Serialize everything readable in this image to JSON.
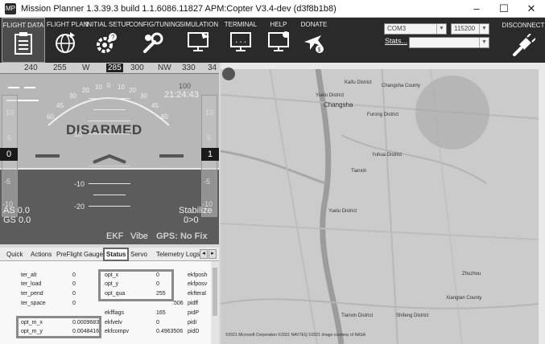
{
  "window": {
    "title": "Mission Planner 1.3.39.3 build 1.1.6086.11827 APM:Copter V3.4-dev (d3f8b1b8)",
    "minimize": "–",
    "maximize": "☐",
    "close": "✕"
  },
  "toolbar": {
    "items": [
      {
        "label": "FLIGHT DATA",
        "icon": "clipboard-icon"
      },
      {
        "label": "FLIGHT PLAN",
        "icon": "globe-icon"
      },
      {
        "label": "INITIAL SETUP",
        "icon": "gear-icon"
      },
      {
        "label": "CONFIG/TUNING",
        "icon": "wrench-icon"
      },
      {
        "label": "SIMULATION",
        "icon": "monitor-icon"
      },
      {
        "label": "TERMINAL",
        "icon": "terminal-icon"
      },
      {
        "label": "HELP",
        "icon": "help-monitor-icon"
      },
      {
        "label": "DONATE",
        "icon": "donate-plane-icon"
      }
    ],
    "port_value": "COM3",
    "baud_value": "115200",
    "stats_label": "Stats...",
    "stats_value": "",
    "disconnect_label": "DISCONNECT"
  },
  "hud": {
    "compass_labels": [
      "240",
      "255",
      "W",
      "285",
      "300",
      "NW",
      "330",
      "34"
    ],
    "status": "DISARMED",
    "time": "21:24:43",
    "speed_top": "100",
    "airspeed": "AS 0.0",
    "groundspeed": "GS 0.0",
    "mode": "Stabilize",
    "mode_sub": "0>0",
    "left_tape_value": "0",
    "right_tape_value": "1",
    "left_tape_ticks": [
      "10",
      "5",
      "-5",
      "-10"
    ],
    "right_tape_ticks": [
      "10",
      "5",
      "-5",
      "-10"
    ],
    "pitch_labels": [
      "10",
      "-10",
      "-20"
    ],
    "roll_labels": [
      "60",
      "45",
      "30",
      "20",
      "10",
      "0",
      "10",
      "20",
      "30",
      "45",
      "60"
    ],
    "ekf": "EKF",
    "vibe": "Vibe",
    "gps": "GPS: No Fix"
  },
  "tabs": {
    "items": [
      "Quick",
      "Actions",
      "PreFlight",
      "Gauges",
      "Status",
      "Servo",
      "Telemetry Logs"
    ],
    "active": "Status",
    "prev": "◂",
    "next": "▸"
  },
  "status_table": {
    "col1_names": [
      "ter_alt",
      "ter_load",
      "ter_pend",
      "ter_space",
      "",
      "opt_m_x",
      "opt_m_y"
    ],
    "col1_values": [
      "0",
      "0",
      "0",
      "0",
      "",
      "0.0009683",
      "0.0048416"
    ],
    "col2_names": [
      "opt_x",
      "opt_y",
      "opt_qua",
      "",
      "ekfflags",
      "ekfvelv",
      "ekfcompv"
    ],
    "col2_values": [
      "0",
      "0",
      "255",
      "",
      "165",
      "0",
      "0.4963506"
    ],
    "col3_names": [
      "ekfposh",
      "ekfposv",
      "ekfteral",
      "pidff",
      "pidP",
      "pidI",
      "pidD"
    ],
    "partial_value": ".506"
  },
  "map": {
    "labels": [
      "Kaifu District",
      "Changsha County",
      "Yuelu District",
      "Changsha",
      "Furong District",
      "Yuhua District",
      "Tianxin",
      "Yuelu District",
      "Tianxin District",
      "Shifeng District",
      "Xiangtan County",
      "Zhuzhou"
    ],
    "copyright": "©2021 Microsoft Corporation ©2021 NAVTEQ ©2021 Image courtesy of NASA"
  }
}
